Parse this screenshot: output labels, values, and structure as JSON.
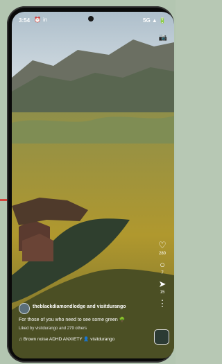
{
  "status_bar": {
    "time": "3:54",
    "network": "5G"
  },
  "post": {
    "username": "theblackdiamondlodge and visitdurango",
    "caption": "For those of you who need to see some green",
    "liked_by": "Liked by visitdurango and 279 others",
    "music": "Brown noise ADHD ANXIETY",
    "music_user": "visitdurango"
  },
  "actions": {
    "likes": "280",
    "comments": "7",
    "shares": "15"
  },
  "icons": {
    "camera": "camera-icon",
    "heart": "heart-icon",
    "comment": "comment-icon",
    "send": "send-icon",
    "more": "more-icon",
    "music": "music-icon"
  }
}
